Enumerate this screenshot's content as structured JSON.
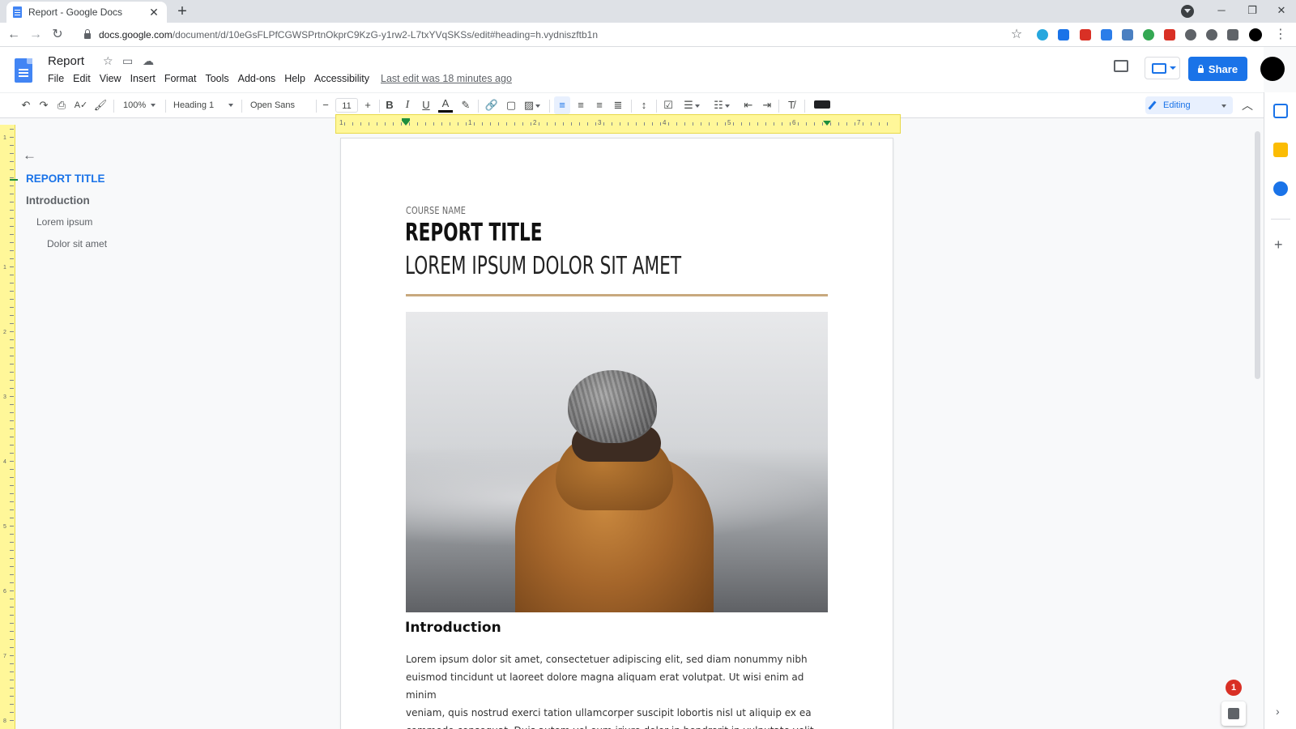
{
  "browser": {
    "tab_title": "Report - Google Docs",
    "url_host": "docs.google.com",
    "url_path": "/document/d/10eGsFLPfCGWSPrtnOkprC9KzG-y1rw2-L7txYVqSKSs/edit#heading=h.vydniszftb1n"
  },
  "docs": {
    "title": "Report",
    "menu": [
      "File",
      "Edit",
      "View",
      "Insert",
      "Format",
      "Tools",
      "Add-ons",
      "Help",
      "Accessibility"
    ],
    "last_edit": "Last edit was 18 minutes ago",
    "share_label": "Share"
  },
  "toolbar": {
    "zoom": "100%",
    "style": "Heading 1",
    "font": "Open Sans",
    "font_size": "11",
    "mode": "Editing"
  },
  "ruler": {
    "numbers": [
      "1",
      "1",
      "2",
      "3",
      "4",
      "5",
      "6",
      "7"
    ]
  },
  "vruler": {
    "numbers": [
      "1",
      "1",
      "2",
      "3",
      "4",
      "5",
      "6",
      "7",
      "8"
    ]
  },
  "outline": {
    "items": [
      "REPORT TITLE",
      "Introduction",
      "Lorem ipsum",
      "Dolor sit amet"
    ]
  },
  "page": {
    "course_name": "COURSE NAME",
    "title": "REPORT TITLE",
    "subtitle": "LOREM IPSUM DOLOR SIT AMET",
    "section_heading": "Introduction",
    "body_lines": [
      "Lorem ipsum dolor sit amet, consectetuer adipiscing elit, sed diam nonummy nibh",
      "euismod tincidunt ut laoreet dolore magna aliquam erat volutpat. Ut wisi enim ad minim",
      "veniam, quis nostrud exerci tation ullamcorper suscipit lobortis nisl ut aliquip ex ea",
      "commodo consequat. Duis autem vel eum iriure dolor in hendrerit in vulputate velit esse"
    ]
  },
  "notifications": {
    "count": "1"
  },
  "colors": {
    "accent": "#1a73e8",
    "ruler_highlight": "#fff799",
    "title_rule": "#c8a97e",
    "indent_marker": "#1e8e3e"
  }
}
